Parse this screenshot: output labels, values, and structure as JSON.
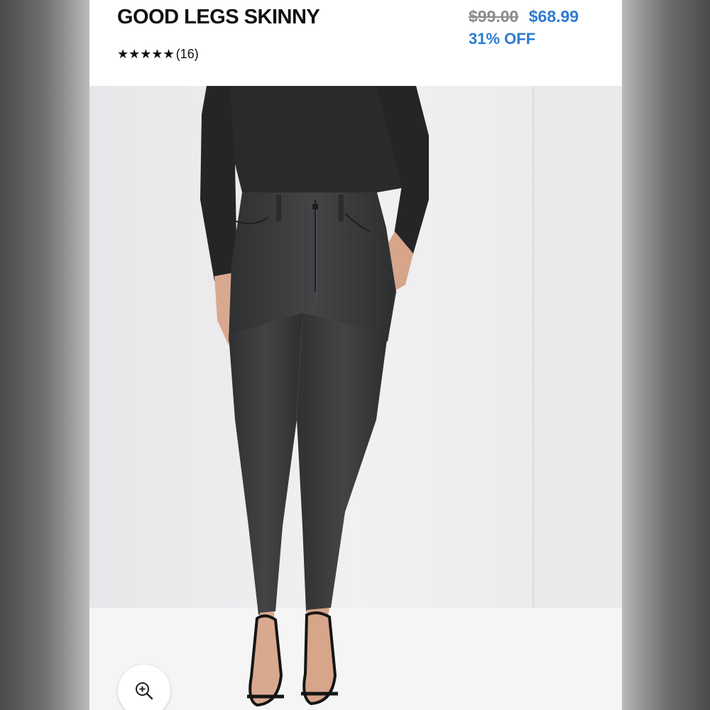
{
  "product": {
    "title": "GOOD LEGS SKINNY",
    "rating_stars": "★★★★★",
    "review_count": "(16)",
    "original_price": "$99.00",
    "sale_price": "$68.99",
    "discount": "31% OFF"
  },
  "image": {
    "alt": "Model wearing black skinny jeans with black long-sleeve bodysuit and strappy heels"
  },
  "icons": {
    "zoom": "zoom-in-icon"
  },
  "colors": {
    "sale": "#2c7bd1",
    "original": "#8c8c8c",
    "denim": "#3a3b3d"
  }
}
